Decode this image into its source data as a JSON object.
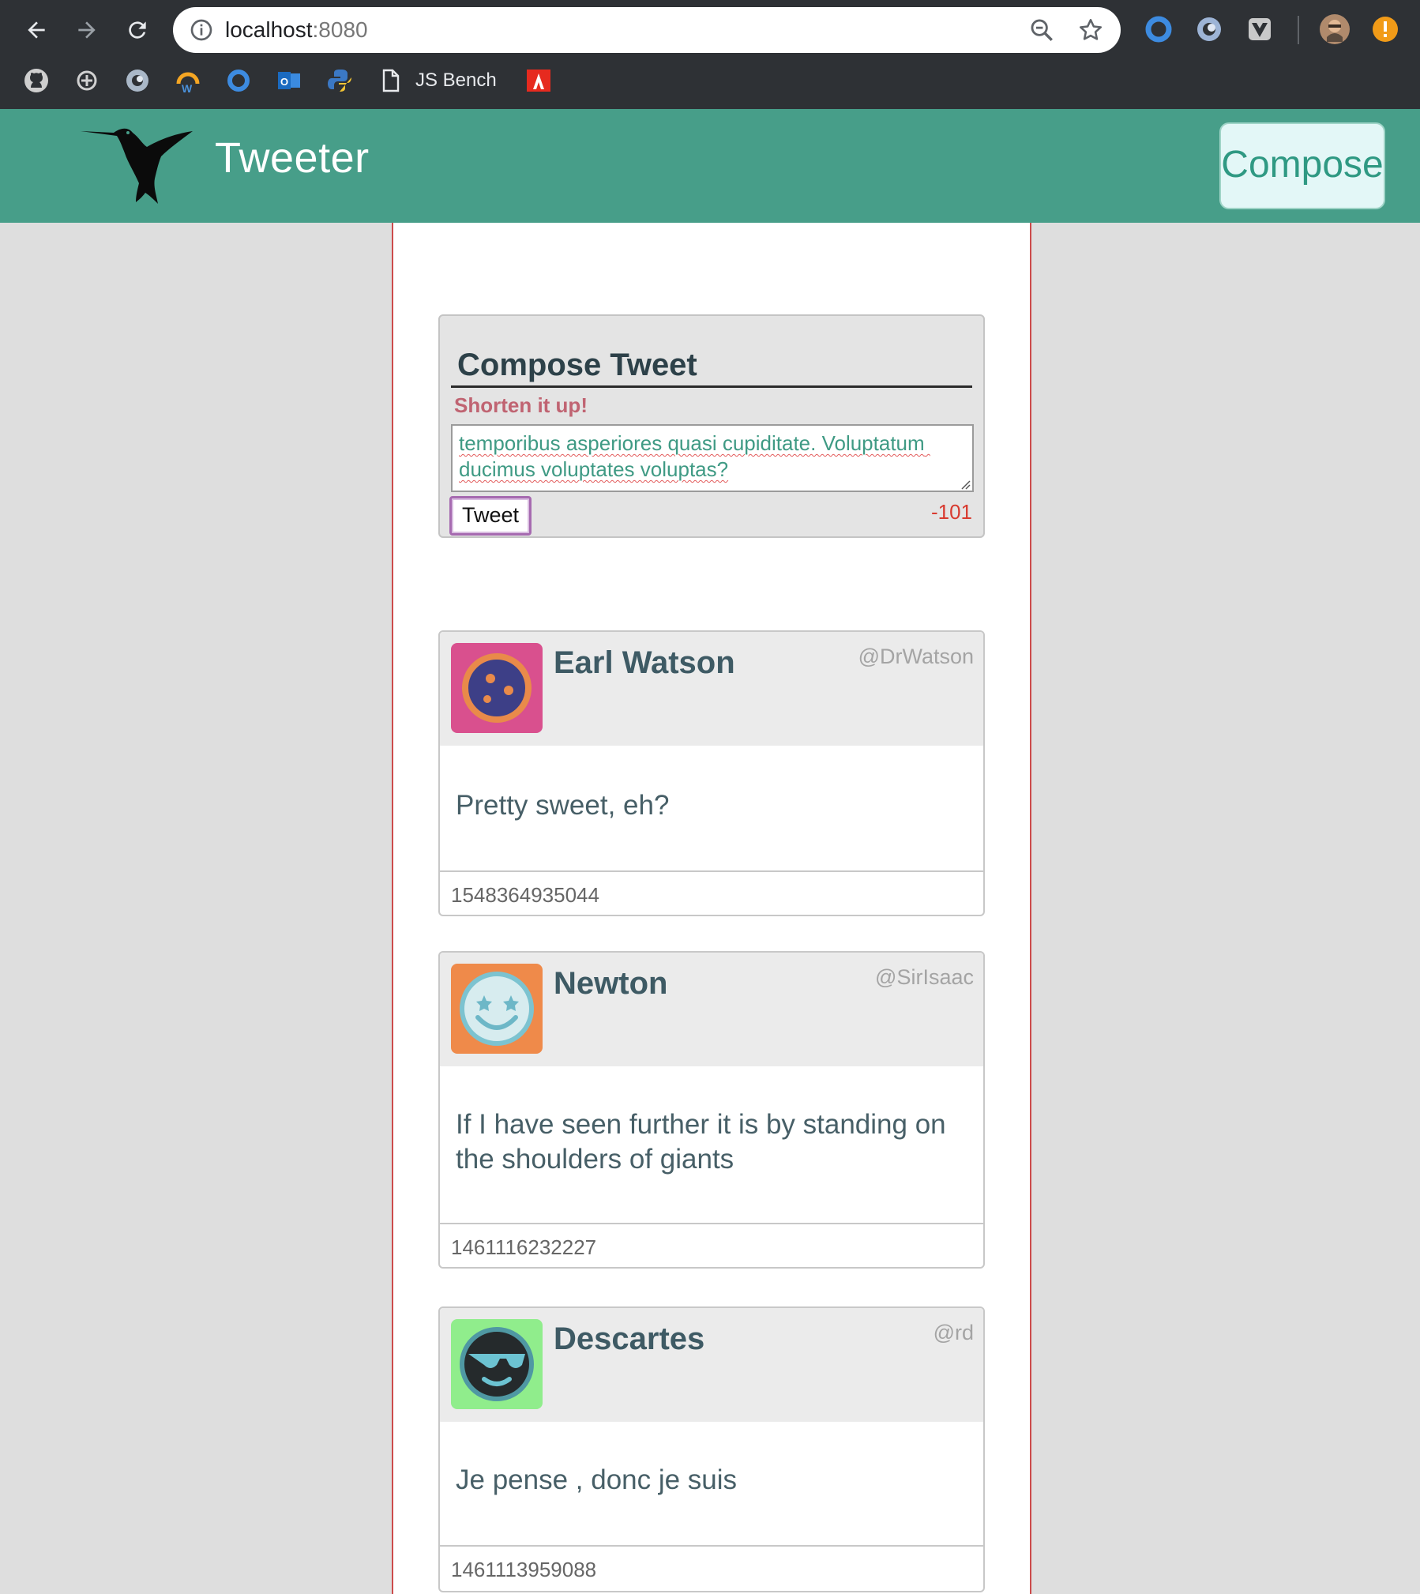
{
  "browser": {
    "url_host": "localhost",
    "url_port": ":8080",
    "bookmark_label": "JS Bench"
  },
  "header": {
    "brand": "Tweeter",
    "compose_label": "Compose",
    "bg_color": "#479e89"
  },
  "compose": {
    "title": "Compose Tweet",
    "error": "Shorten it up!",
    "text_value": "temporibus asperiores quasi cupiditate. Voluptatum ducimus voluptates voluptas?",
    "submit_label": "Tweet",
    "counter": "-101"
  },
  "tweets": [
    {
      "name": "Earl Watson",
      "handle": "@DrWatson",
      "body": "Pretty sweet, eh?",
      "timestamp": "1548364935044",
      "avatar_icon": "purple-face-avatar-icon"
    },
    {
      "name": "Newton",
      "handle": "@SirIsaac",
      "body": "If I have seen further it is by standing on the shoulders of giants",
      "timestamp": "1461116232227",
      "avatar_icon": "star-eyes-avatar-icon"
    },
    {
      "name": "Descartes",
      "handle": "@rd",
      "body": "Je pense , donc je suis",
      "timestamp": "1461113959088",
      "avatar_icon": "sunglasses-avatar-icon"
    }
  ]
}
